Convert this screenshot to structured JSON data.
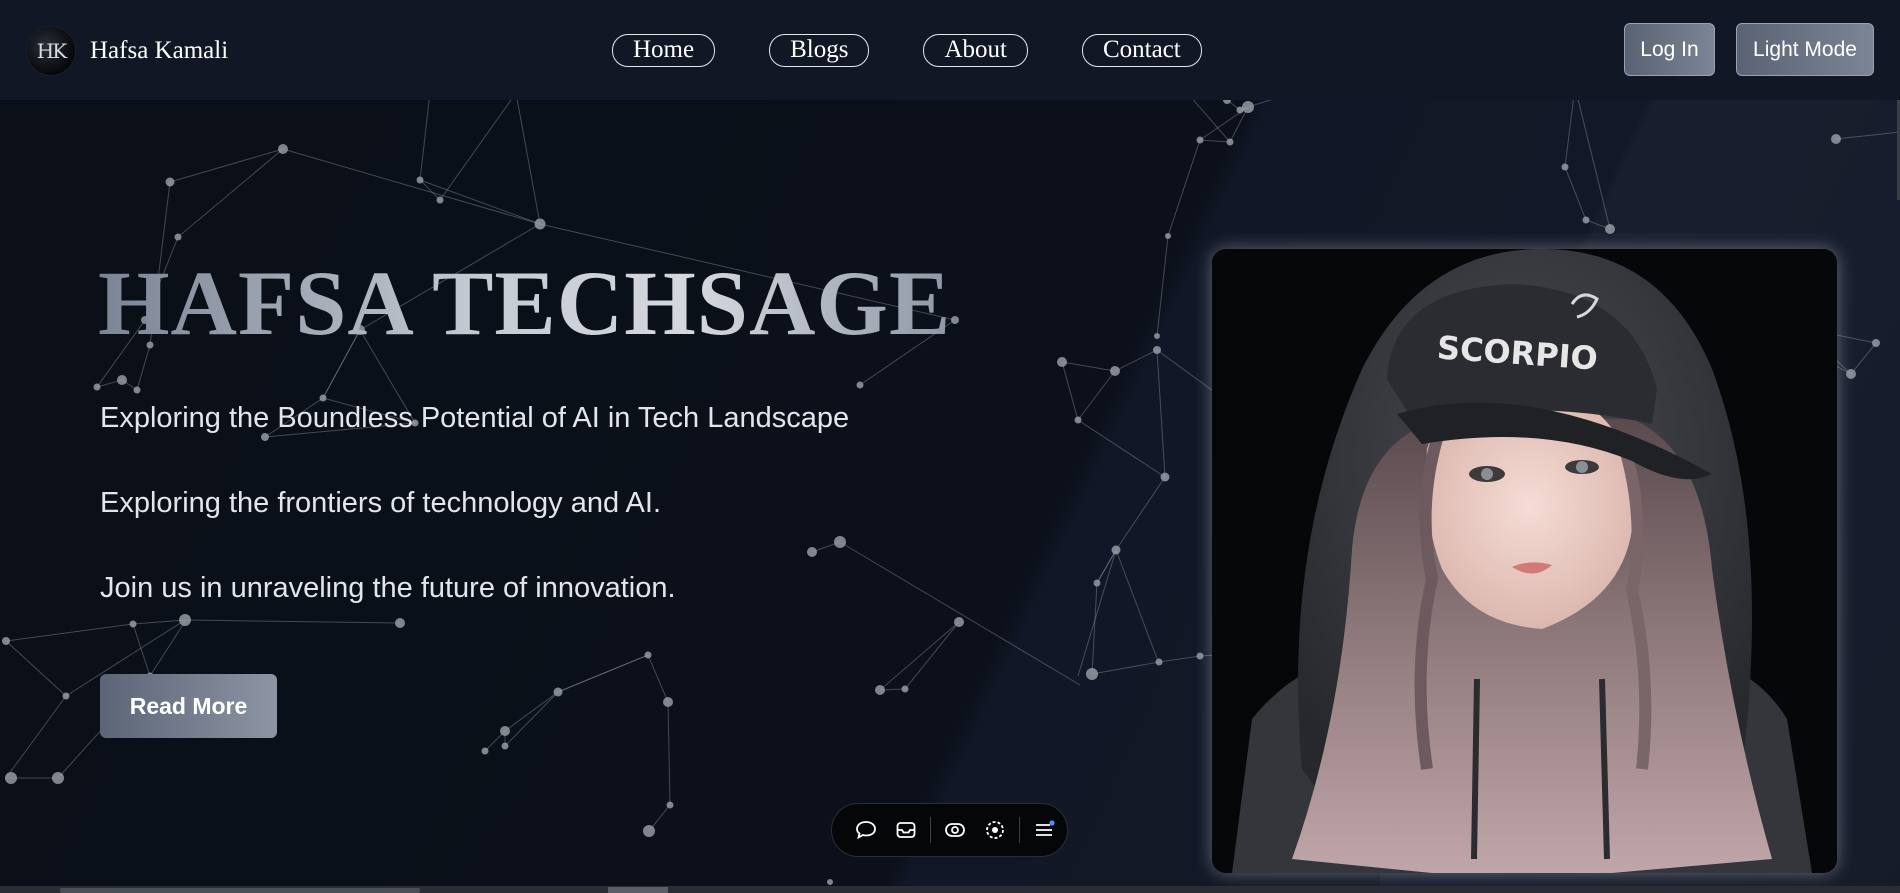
{
  "header": {
    "brand_name": "Hafsa Kamali",
    "logo_text": "HK",
    "nav": [
      "Home",
      "Blogs",
      "About",
      "Contact"
    ],
    "login_label": "Log In",
    "theme_label": "Light Mode"
  },
  "hero": {
    "title": "HAFSA TECHSAGE",
    "line1": "Exploring the Boundless Potential of AI in Tech Landscape",
    "line2": "Exploring the frontiers of technology and AI.",
    "line3": "Join us in unraveling the future of innovation.",
    "cta_label": "Read More"
  },
  "portrait": {
    "cap_text": "SCORPIO"
  },
  "toolbar": {
    "icons": [
      "comment-icon",
      "inbox-icon",
      "eye-icon",
      "target-icon",
      "menu-icon"
    ]
  },
  "colors": {
    "background": "#0a0f18",
    "header": "#111725",
    "accent_button": "#6b7384"
  }
}
